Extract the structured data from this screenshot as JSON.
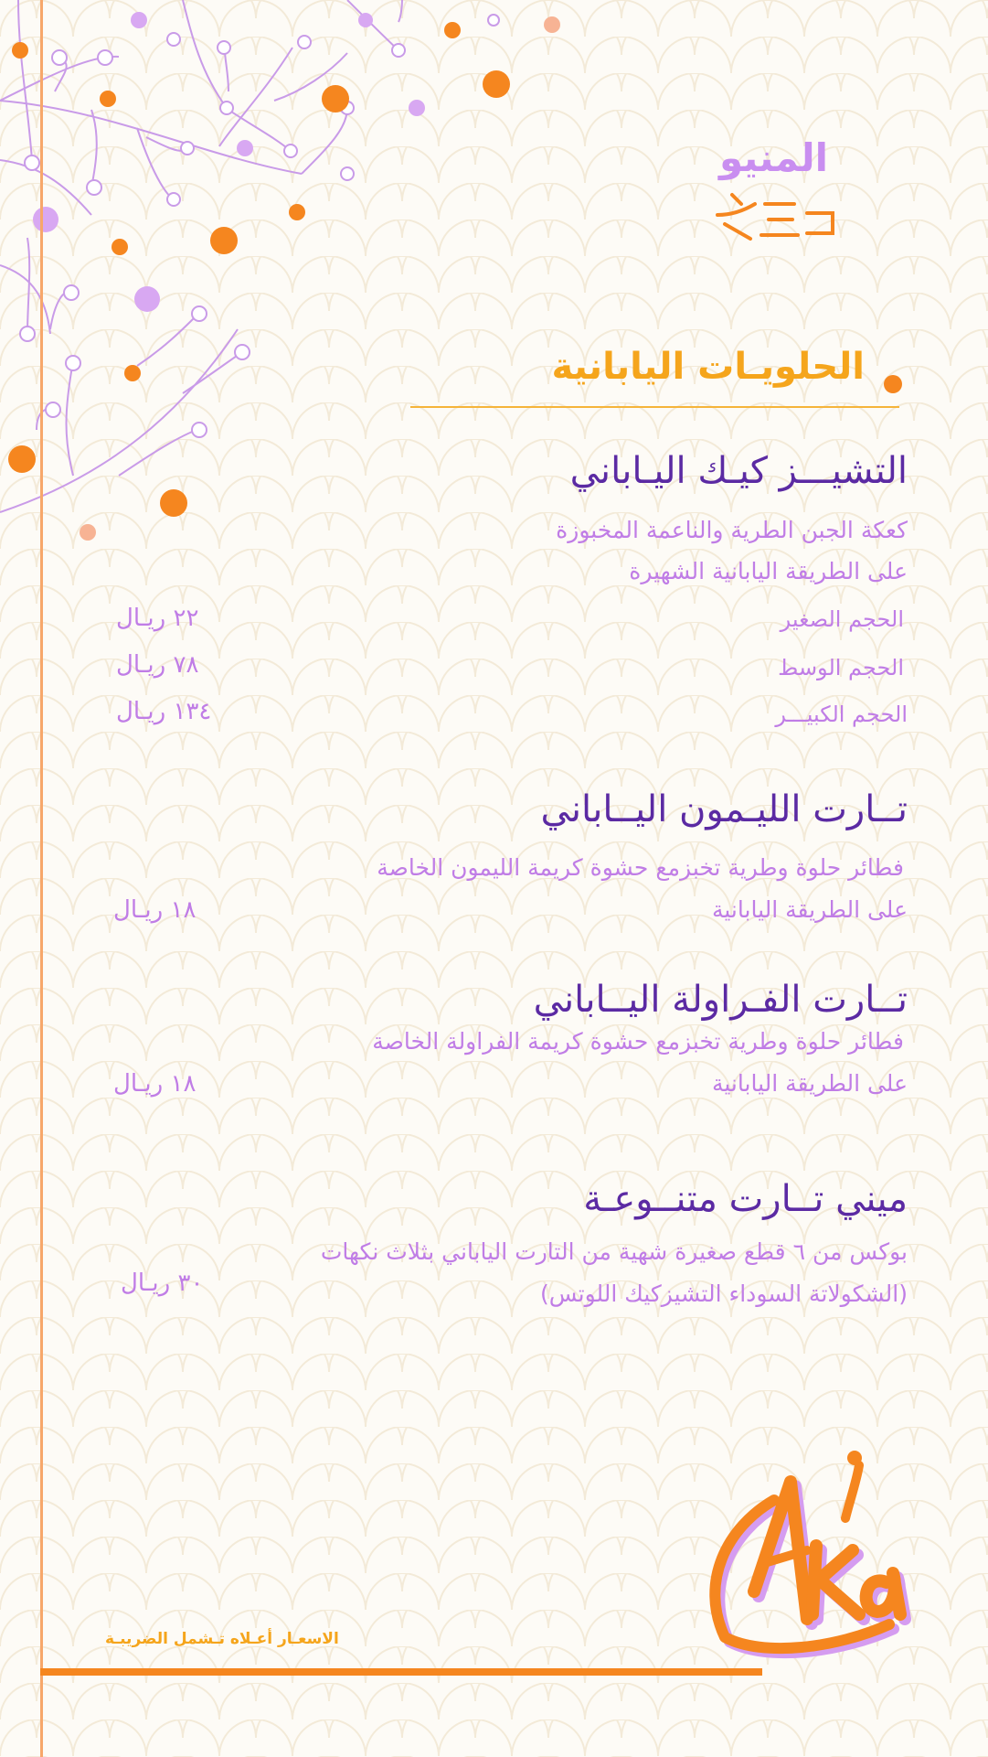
{
  "header": {
    "menu_title": "المنيو"
  },
  "section": {
    "title": "الحلويـات اليابانية"
  },
  "items": [
    {
      "name": "التشيـــز كيـك اليـاباني",
      "desc1": "كعكة الجبن الطرية والناعمة المخبوزة",
      "desc2": "على الطريقة اليابانية الشهيرة",
      "sizes": [
        {
          "label": "الحجم الصغير",
          "price": "٢٢ ريـال"
        },
        {
          "label": "الحجم الوسط",
          "price": "٧٨ ريـال"
        },
        {
          "label": "الحجم الكبيـــر",
          "price": "١٣٤ ريـال"
        }
      ]
    },
    {
      "name": "تــارت الليـمون اليــاباني",
      "desc1": "فطائر حلوة وطرية تخبزمع حشوة كريمة الليمون الخاصة",
      "desc2": "على الطريقة اليابانية",
      "price": "١٨ ريـال"
    },
    {
      "name": "تــارت الفـراولة اليــاباني",
      "desc1": "فطائر حلوة وطرية تخبزمع حشوة كريمة الفراولة الخاصة",
      "desc2": "على الطريقة اليابانية",
      "price": "١٨ ريـال"
    },
    {
      "name": "ميني تــارت متنــوعـة",
      "desc1": "بوكس من ٦ قطع صغيرة شهية من التارت الياباني بثلاث نكهات",
      "desc2": "(الشكولاتة السوداء التشيزكيك اللوتس)",
      "price": "٣٠ ريـال"
    }
  ],
  "footer": {
    "tax_note": "الاسعـار أعـلاه تـشمل الضريبـة"
  },
  "logo": {
    "text": "Akira"
  },
  "colors": {
    "orange": "#f5861f",
    "lilac": "#c98ef0",
    "purple": "#5b2aa3",
    "gold": "#f5a51c"
  }
}
